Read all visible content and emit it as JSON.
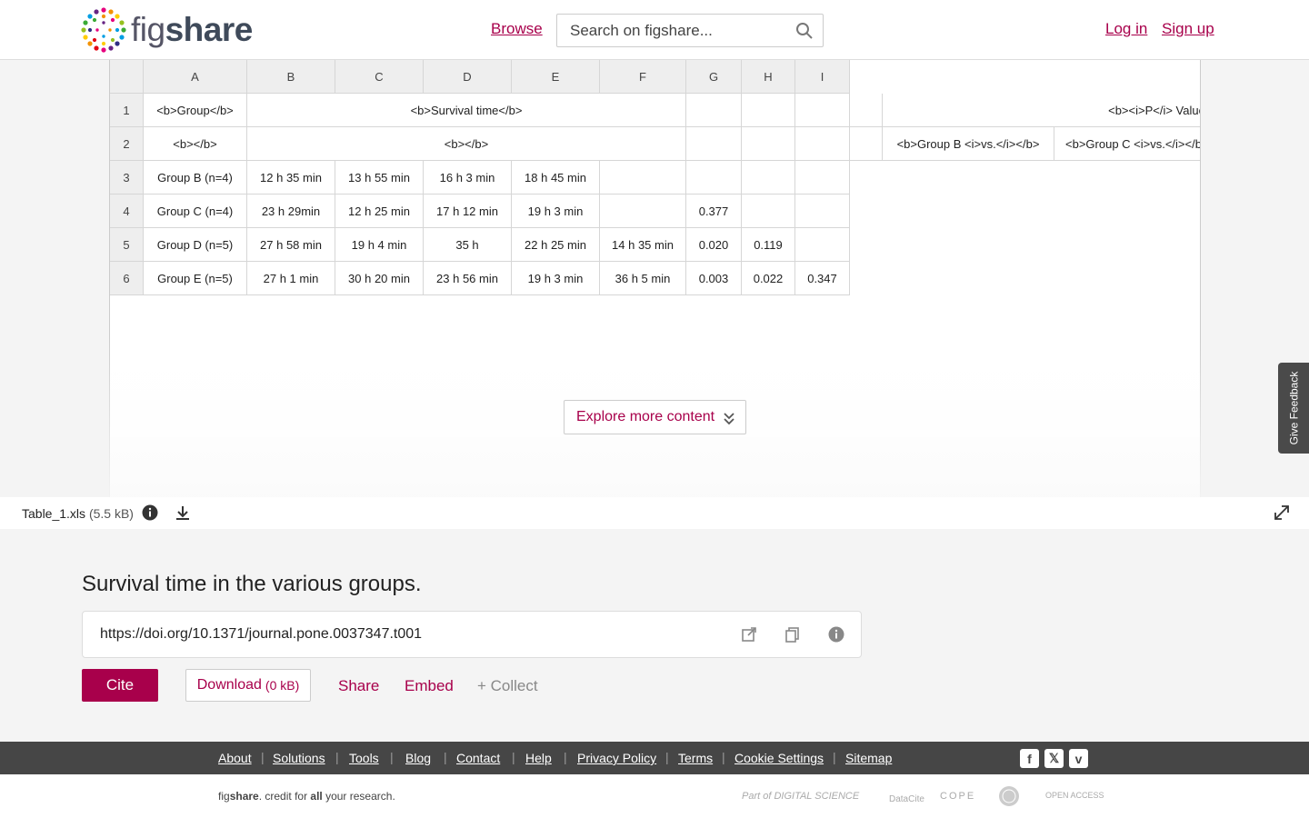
{
  "header": {
    "logo_text_prefix": "fig",
    "logo_text_suffix": "share",
    "browse": "Browse",
    "search_placeholder": "Search on figshare...",
    "login": "Log in",
    "signup": "Sign up"
  },
  "spreadsheet": {
    "column_headers": [
      "A",
      "B",
      "C",
      "D",
      "E",
      "F",
      "G",
      "H",
      "I"
    ],
    "row_headers": [
      "1",
      "2",
      "3",
      "4",
      "5",
      "6"
    ],
    "row1": {
      "a": "<b>Group</b>",
      "bf": "<b>Survival time</b>",
      "pvalue": "<b><i>P</i> Value</b>"
    },
    "row2": {
      "a": "<b></b>",
      "bf": "<b></b>",
      "groupb_vs": "<b>Group B <i>vs.</i></b>",
      "groupc_vs": "<b>Group C <i>vs.</i></b>"
    },
    "rows": [
      [
        "Group B (n=4)",
        "12 h 35 min",
        "13 h 55 min",
        "16 h 3 min",
        "18 h 45 min",
        "",
        "",
        "",
        ""
      ],
      [
        "Group C (n=4)",
        "23 h 29min",
        "12 h 25 min",
        "17 h 12 min",
        "19 h 3 min",
        "",
        "0.377",
        "",
        ""
      ],
      [
        "Group D (n=5)",
        "27 h 58 min",
        "19 h 4 min",
        "35 h",
        "22 h 25 min",
        "14 h 35 min",
        "0.020",
        "0.119",
        ""
      ],
      [
        "Group E (n=5)",
        "27 h 1 min",
        "30 h 20 min",
        "23 h 56 min",
        "19 h 3 min",
        "36 h 5 min",
        "0.003",
        "0.022",
        "0.347"
      ]
    ]
  },
  "explore": {
    "label": "Explore more content"
  },
  "feedback": {
    "label": "Give Feedback"
  },
  "file": {
    "name": "Table_1.xls",
    "size": "(5.5 kB)"
  },
  "details": {
    "title": "Survival time in the various groups.",
    "doi": "https://doi.org/10.1371/journal.pone.0037347.t001",
    "cite": "Cite",
    "download": "Download",
    "download_size": "(0 kB)",
    "share": "Share",
    "embed": "Embed",
    "collect": "+ Collect"
  },
  "footer": {
    "links": [
      "About",
      "Solutions",
      "Tools",
      "Blog",
      "Contact",
      "Help",
      "Privacy Policy",
      "Terms",
      "Cookie Settings",
      "Sitemap"
    ],
    "tagline_pre": "fig",
    "tagline_brand": "share",
    "tagline_mid": ". credit for ",
    "tagline_all": "all",
    "tagline_post": " your research.",
    "partners": [
      "Part of DIGITAL SCIENCE",
      "DataCite",
      "COPE",
      "OPEN ACCESS"
    ]
  },
  "colors": {
    "accent": "#a8004b",
    "footer_bg": "#464646",
    "page_bg": "#f4f4f4"
  }
}
